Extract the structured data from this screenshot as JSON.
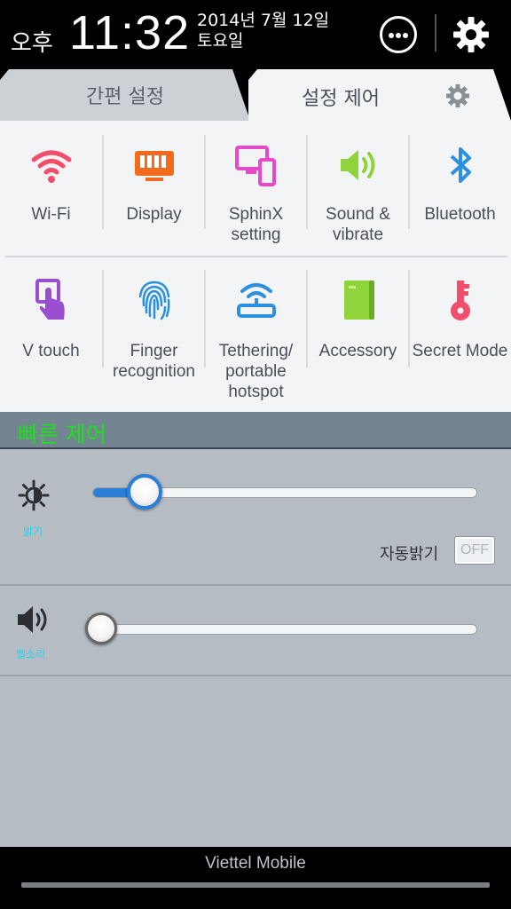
{
  "status": {
    "ampm": "오후",
    "time": "11:32",
    "date_line1": "2014년 7월 12일",
    "date_line2": "토요일"
  },
  "header_icons": [
    "more-icon",
    "gear-icon"
  ],
  "tabs": [
    {
      "label": "간편 설정",
      "active": false
    },
    {
      "label": "설정 제어",
      "active": true
    }
  ],
  "settings_grid": {
    "row1": [
      {
        "label": "Wi-Fi",
        "icon": "wifi-icon",
        "color": "#f04e6a"
      },
      {
        "label": "Display",
        "icon": "display-icon",
        "color": "#f26a1b"
      },
      {
        "label": "SphinX setting",
        "icon": "devices-icon",
        "color": "#e64ac8"
      },
      {
        "label": "Sound & vibrate",
        "icon": "speaker-icon",
        "color": "#8ed43a"
      },
      {
        "label": "Bluetooth",
        "icon": "bluetooth-icon",
        "color": "#2d8fe0"
      }
    ],
    "row2": [
      {
        "label": "V touch",
        "icon": "touch-icon",
        "color": "#9b4fd0"
      },
      {
        "label": "Finger recognition",
        "icon": "fingerprint-icon",
        "color": "#2d8fe0"
      },
      {
        "label": "Tethering/ portable hotspot",
        "icon": "hotspot-icon",
        "color": "#2d8fe0"
      },
      {
        "label": "Accessory",
        "icon": "accessory-icon",
        "color": "#8ed43a"
      },
      {
        "label": "Secret Mode",
        "icon": "key-icon",
        "color": "#f04e6a"
      }
    ]
  },
  "quick_control": {
    "title": "빠른 제어",
    "brightness": {
      "label": "밝기",
      "level": 0.1
    },
    "auto_brightness": {
      "label": "자동밝기",
      "state": "OFF"
    },
    "volume": {
      "label": "벨소리",
      "level": 0.0
    }
  },
  "carrier": "Viettel Mobile"
}
